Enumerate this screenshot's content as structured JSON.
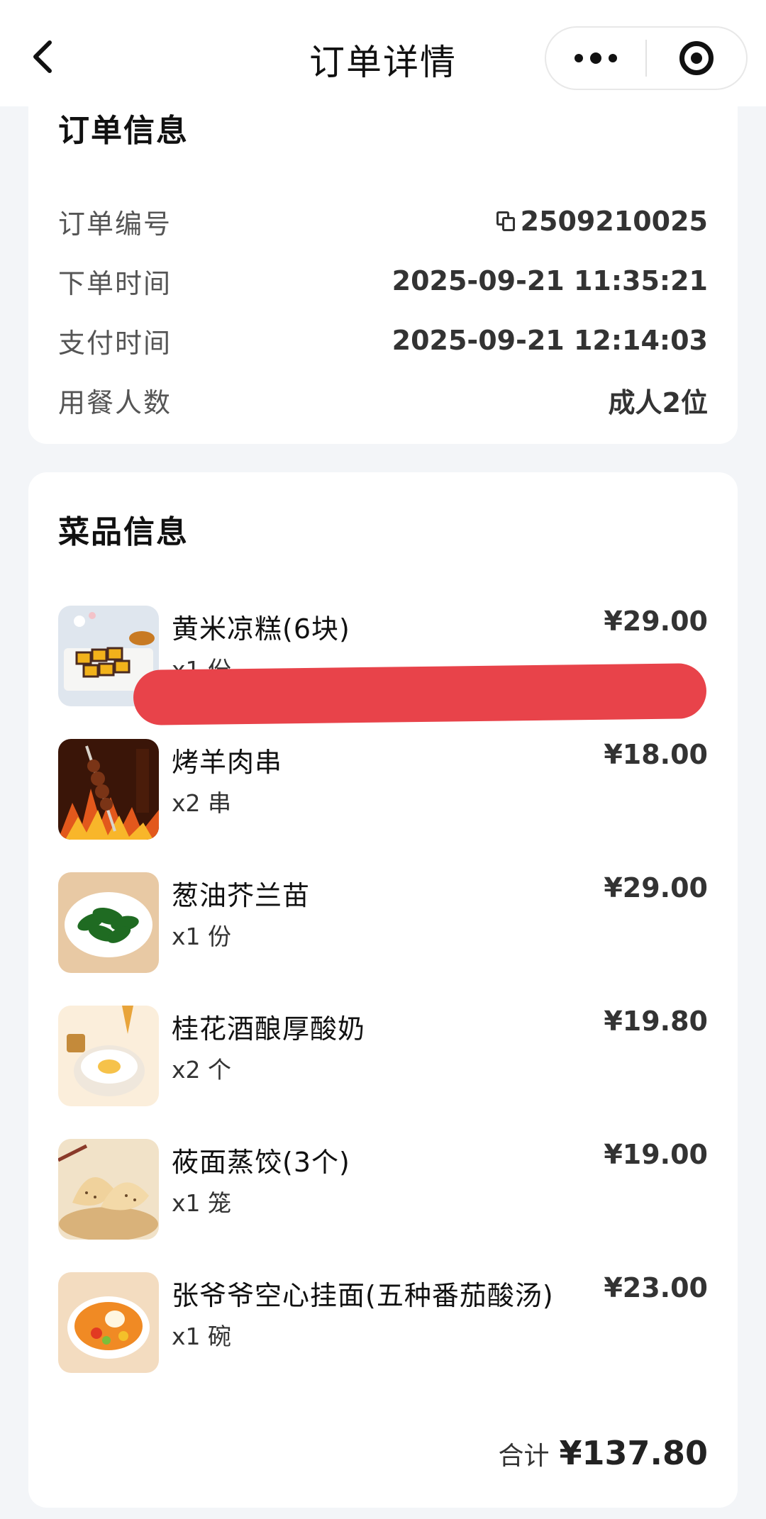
{
  "nav": {
    "title": "订单详情"
  },
  "order_info": {
    "title": "订单信息",
    "rows": [
      {
        "label": "订单编号",
        "value": "2509210025"
      },
      {
        "label": "下单时间",
        "value": "2025-09-21 11:35:21"
      },
      {
        "label": "支付时间",
        "value": "2025-09-21 12:14:03"
      },
      {
        "label": "用餐人数",
        "value": "成人2位"
      }
    ]
  },
  "dish_info": {
    "title": "菜品信息",
    "items": [
      {
        "name": "黄米凉糕(6块)",
        "qty": "x1 份",
        "price": "¥29.00",
        "image": "yellow-rice-cake-photo"
      },
      {
        "name": "烤羊肉串",
        "qty": "x2 串",
        "price": "¥18.00",
        "image": "lamb-skewer-photo"
      },
      {
        "name": "葱油芥兰苗",
        "qty": "x1 份",
        "price": "¥29.00",
        "image": "kale-sprouts-photo"
      },
      {
        "name": "桂花酒酿厚酸奶",
        "qty": "x2 个",
        "price": "¥19.80",
        "image": "osmanthus-yogurt-photo"
      },
      {
        "name": "莜面蒸饺(3个)",
        "qty": "x1 笼",
        "price": "¥19.00",
        "image": "oat-dumpling-photo"
      },
      {
        "name": "张爷爷空心挂面(五种番茄酸汤)",
        "qty": "x1 碗",
        "price": "¥23.00",
        "image": "tomato-noodle-photo"
      }
    ],
    "total_label": "合计",
    "total_value": "¥137.80"
  },
  "colors": {
    "background": "#f3f5f8",
    "card": "#ffffff",
    "redaction": "#e8434a"
  }
}
